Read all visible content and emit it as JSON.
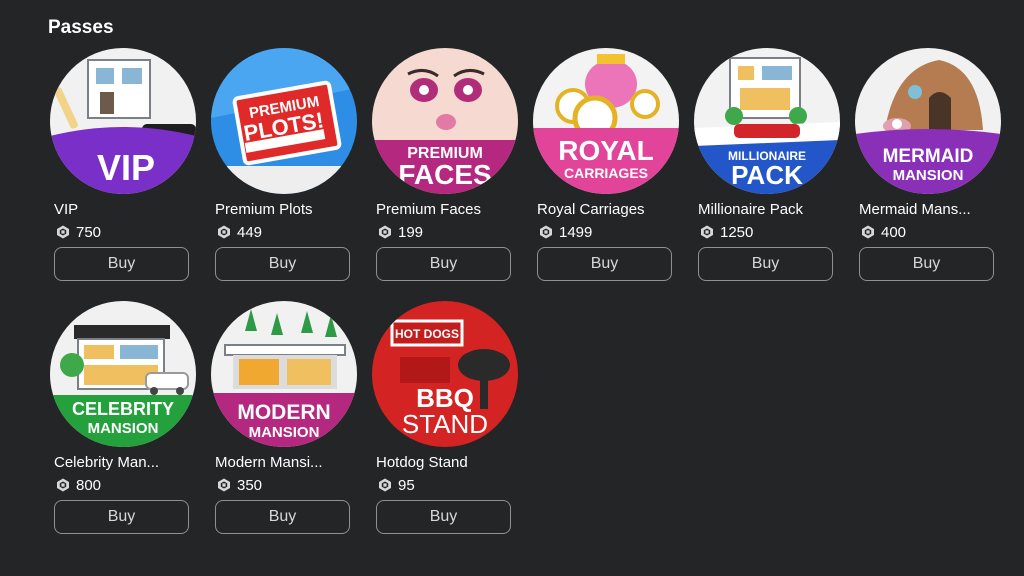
{
  "section": {
    "title": "Passes"
  },
  "icons": {
    "currency": "robux-icon"
  },
  "passes": [
    {
      "name": "VIP",
      "price": "750",
      "buy_label": "Buy",
      "badge_line1": "VIP",
      "badge_line2": ""
    },
    {
      "name": "Premium Plots",
      "price": "449",
      "buy_label": "Buy",
      "badge_line1": "PREMIUM",
      "badge_line2": "PLOTS!"
    },
    {
      "name": "Premium Faces",
      "price": "199",
      "buy_label": "Buy",
      "badge_line1": "PREMIUM",
      "badge_line2": "FACES"
    },
    {
      "name": "Royal Carriages",
      "price": "1499",
      "buy_label": "Buy",
      "badge_line1": "ROYAL",
      "badge_line2": "CARRIAGES"
    },
    {
      "name": "Millionaire Pack",
      "price": "1250",
      "buy_label": "Buy",
      "badge_line1": "MILLIONAIRE",
      "badge_line2": "PACK"
    },
    {
      "name": "Mermaid Mans...",
      "price": "400",
      "buy_label": "Buy",
      "badge_line1": "MERMAID",
      "badge_line2": "MANSION"
    },
    {
      "name": "Celebrity Man...",
      "price": "800",
      "buy_label": "Buy",
      "badge_line1": "CELEBRITY",
      "badge_line2": "MANSION"
    },
    {
      "name": "Modern Mansi...",
      "price": "350",
      "buy_label": "Buy",
      "badge_line1": "MODERN",
      "badge_line2": "MANSION"
    },
    {
      "name": "Hotdog Stand",
      "price": "95",
      "buy_label": "Buy",
      "badge_line1": "BBQ",
      "badge_line2": "STAND",
      "sign_text": "HOT DOGS"
    }
  ]
}
